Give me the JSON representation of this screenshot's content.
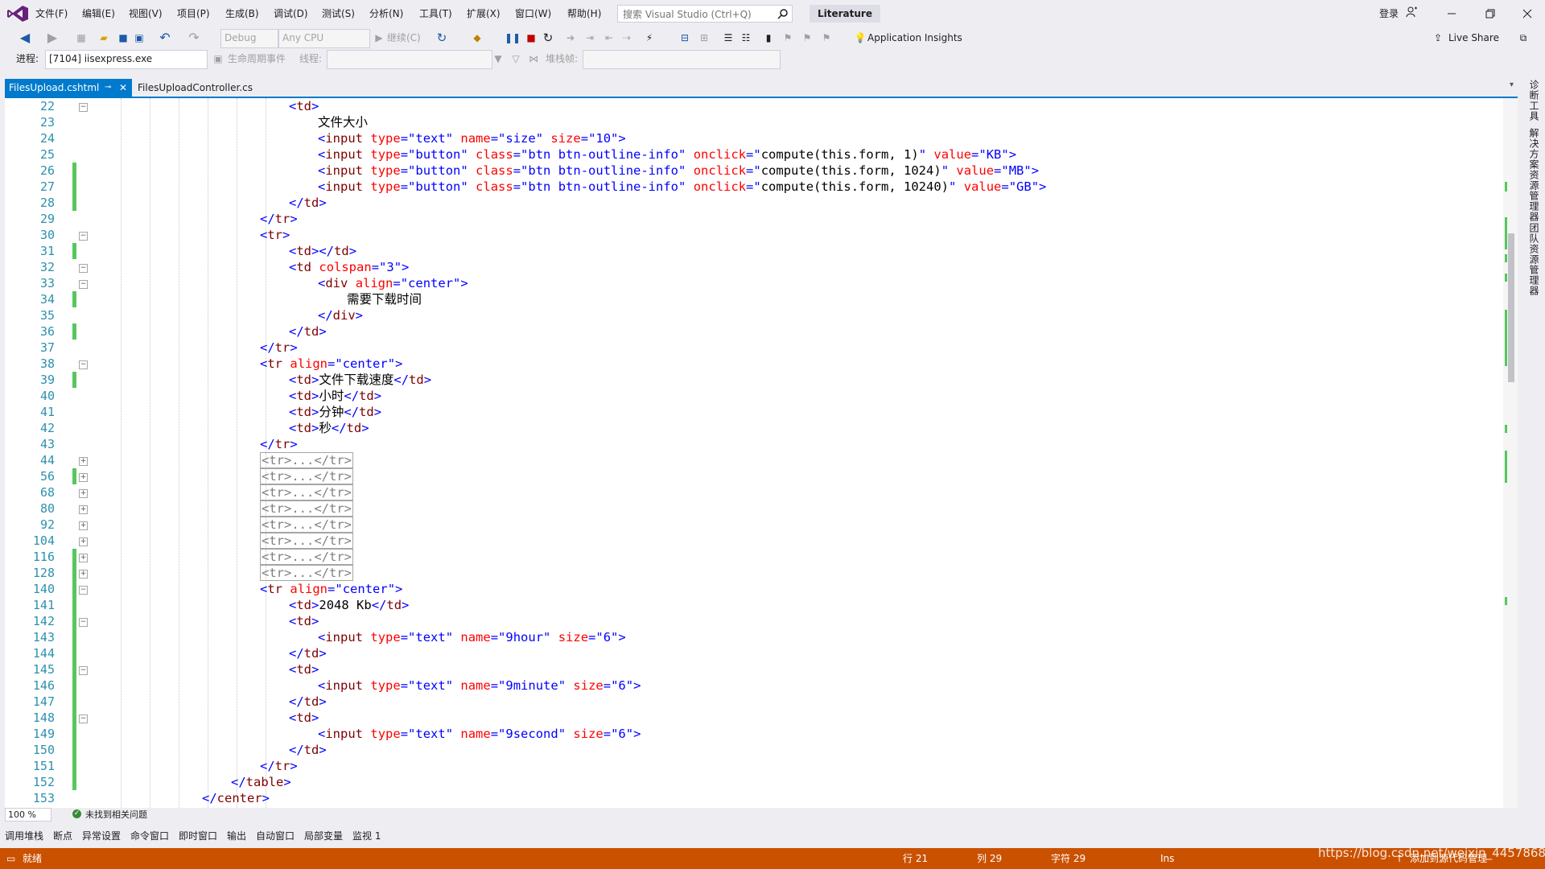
{
  "menu": {
    "items": [
      "文件(F)",
      "编辑(E)",
      "视图(V)",
      "项目(P)",
      "生成(B)",
      "调试(D)",
      "测试(S)",
      "分析(N)",
      "工具(T)",
      "扩展(X)",
      "窗口(W)",
      "帮助(H)"
    ],
    "search_placeholder": "搜索 Visual Studio (Ctrl+Q)",
    "solution_name": "Literature",
    "sign_in": "登录"
  },
  "toolbar": {
    "config": "Debug",
    "platform": "Any CPU",
    "continue_label": "继续(C)",
    "app_insights": "Application Insights",
    "live_share": "Live Share"
  },
  "debugbar": {
    "process_label": "进程:",
    "process_value": "[7104] iisexpress.exe",
    "lifecycle_label": "生命周期事件",
    "thread_label": "线程:",
    "stackframe_label": "堆栈帧:"
  },
  "tabs": {
    "active": "FilesUpload.cshtml",
    "inactive": "FilesUploadController.cs"
  },
  "editor": {
    "line_numbers": [
      "22",
      "23",
      "24",
      "25",
      "26",
      "27",
      "28",
      "29",
      "30",
      "31",
      "32",
      "33",
      "34",
      "35",
      "36",
      "37",
      "38",
      "39",
      "40",
      "41",
      "42",
      "43",
      "44",
      "56",
      "68",
      "80",
      "92",
      "104",
      "116",
      "128",
      "140",
      "141",
      "142",
      "143",
      "144",
      "145",
      "146",
      "147",
      "148",
      "149",
      "150",
      "151",
      "152",
      "153"
    ]
  },
  "side_tabs": [
    "诊断工具",
    "解决方案资源管理器",
    "团队资源管理器"
  ],
  "zoom": "100 %",
  "issues": "未找到相关问题",
  "panel_tabs": [
    "调用堆栈",
    "断点",
    "异常设置",
    "命令窗口",
    "即时窗口",
    "输出",
    "自动窗口",
    "局部变量",
    "监视 1"
  ],
  "status": {
    "ready": "就绪",
    "line": "行 21",
    "col": "列 29",
    "char": "字符 29",
    "ins": "Ins",
    "add_source": "添加到源代码管理",
    "watermark": "https://blog.csdn.net/weixin_44578685"
  },
  "colors": {
    "accent": "#007acc",
    "status": "#ca5100",
    "tag": "#800000",
    "attr": "#ff0000",
    "value": "#0000ff"
  }
}
